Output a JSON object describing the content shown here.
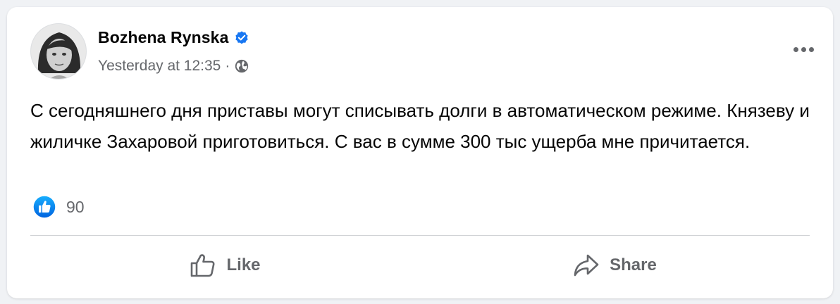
{
  "post": {
    "author": "Bozhena Rynska",
    "verified": true,
    "timestamp": "Yesterday at 12:35",
    "separator": "·",
    "audience_icon": "globe-icon",
    "text": "С сегодняшнего дня приставы могут списывать долги в автоматическом режиме. Князеву и жиличке Захаровой приготовиться. С вас в сумме 300 тыс ущерба мне причитается.",
    "reactions": {
      "icon": "like-icon",
      "count": "90"
    }
  },
  "actions": {
    "like_label": "Like",
    "share_label": "Share"
  },
  "colors": {
    "accent": "#1877f2",
    "secondary_text": "#65676b",
    "primary_text": "#050505",
    "background": "#f0f2f5"
  }
}
